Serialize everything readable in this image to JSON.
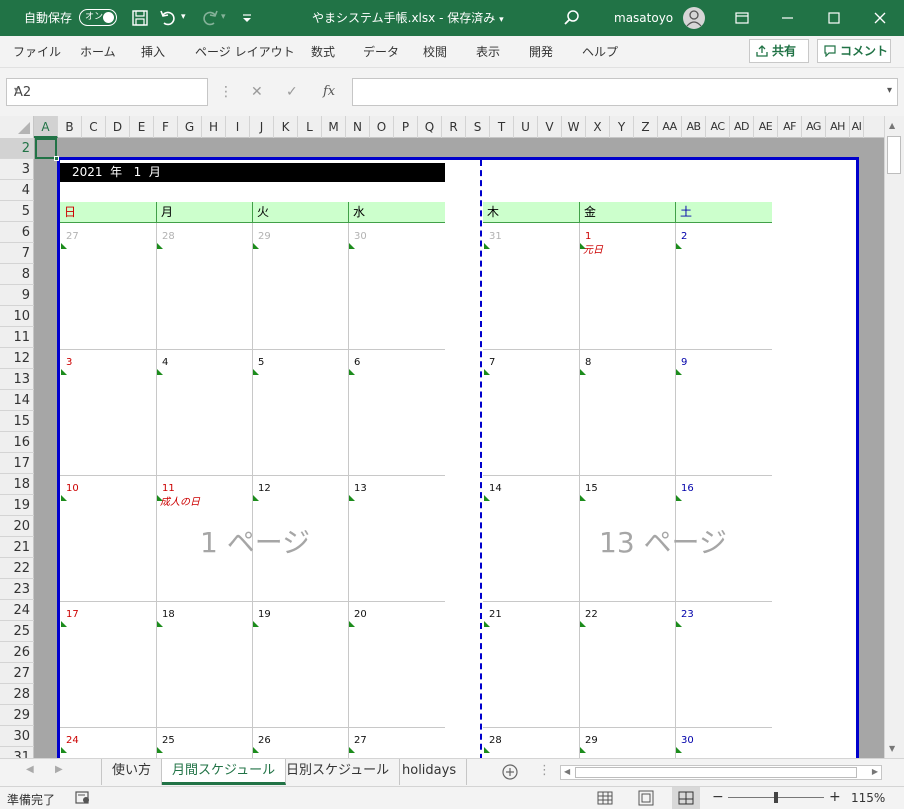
{
  "titlebar": {
    "autosave_label": "自動保存",
    "autosave_toggle": "オン",
    "filename": "やまシステム手帳.xlsx",
    "save_state": "保存済み",
    "user": "masatoyo"
  },
  "ribbon": {
    "tabs": [
      "ファイル",
      "ホーム",
      "挿入",
      "ページ レイアウト",
      "数式",
      "データ",
      "校閲",
      "表示",
      "開発",
      "ヘルプ"
    ],
    "share_label": "共有",
    "comment_label": "コメント"
  },
  "formula_bar": {
    "name_box": "A2",
    "fx": "fx",
    "value": ""
  },
  "columns": [
    "A",
    "B",
    "C",
    "D",
    "E",
    "F",
    "G",
    "H",
    "I",
    "J",
    "K",
    "L",
    "M",
    "N",
    "O",
    "P",
    "Q",
    "R",
    "S",
    "T",
    "U",
    "V",
    "W",
    "X",
    "Y",
    "Z",
    "AA",
    "AB",
    "AC",
    "AD",
    "AE",
    "AF",
    "AG",
    "AH",
    "AI"
  ],
  "rows": [
    "2",
    "3",
    "4",
    "5",
    "6",
    "7",
    "8",
    "9",
    "10",
    "11",
    "12",
    "13",
    "14",
    "15",
    "16",
    "17",
    "18",
    "19",
    "20",
    "21",
    "22",
    "23",
    "24",
    "25",
    "26",
    "27",
    "28",
    "29",
    "30",
    "31"
  ],
  "calendar": {
    "banner": "2021  年   1  月",
    "days_left": [
      "日",
      "月",
      "火",
      "水"
    ],
    "days_right": [
      "木",
      "金",
      "土"
    ],
    "weeks": [
      [
        "27",
        "28",
        "29",
        "30",
        "31",
        "1",
        "2"
      ],
      [
        "3",
        "4",
        "5",
        "6",
        "7",
        "8",
        "9"
      ],
      [
        "10",
        "11",
        "12",
        "13",
        "14",
        "15",
        "16"
      ],
      [
        "17",
        "18",
        "19",
        "20",
        "21",
        "22",
        "23"
      ],
      [
        "24",
        "25",
        "26",
        "27",
        "28",
        "29",
        "30"
      ]
    ],
    "holidays": {
      "new_year": "元日",
      "coming_of_age": "成人の日"
    },
    "page_left": "1 ページ",
    "page_right": "13 ページ"
  },
  "sheets": [
    "使い方",
    "月間スケジュール",
    "日別スケジュール",
    "holidays"
  ],
  "active_sheet": "月間スケジュール",
  "status": {
    "ready": "準備完了",
    "zoom": "115%"
  }
}
